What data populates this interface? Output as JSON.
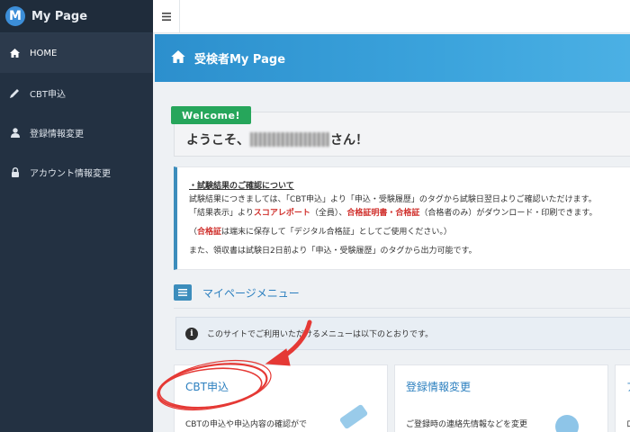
{
  "brand": {
    "logo_letter": "M",
    "title": "My Page"
  },
  "sidebar": {
    "items": [
      {
        "label": "HOME",
        "icon": "home-icon",
        "active": true
      },
      {
        "label": "CBT申込",
        "icon": "pencil-icon",
        "active": false
      },
      {
        "label": "登録情報変更",
        "icon": "user-icon",
        "active": false
      },
      {
        "label": "アカウント情報変更",
        "icon": "lock-icon",
        "active": false
      }
    ]
  },
  "topbar": {
    "menu_icon": "hamburger-icon"
  },
  "header": {
    "title": "受検者My Page",
    "icon": "home-icon"
  },
  "welcome": {
    "badge": "Welcome!",
    "greeting_prefix": "ようこそ、",
    "greeting_suffix": "さん！"
  },
  "notice": {
    "title": "・試験結果のご確認について",
    "line1": "試験結果につきましては、「CBT申込」より「申込・受験履歴」のタグから試験日翌日よりご確認いただけます。",
    "line2_a": "「結果表示」より",
    "line2_b": "スコアレポート",
    "line2_c": "（全員）、",
    "line2_d": "合格証明書・合格証",
    "line2_e": "（合格者のみ）がダウンロード・印刷できます。",
    "line3_a": "（",
    "line3_b": "合格証",
    "line3_c": "は端末に保存して「デジタル合格証」としてご使用ください。）",
    "line4": "また、領収書は試験日2日前より「申込・受験履歴」のタグから出力可能です。"
  },
  "menu_section": {
    "title": "マイページメニュー",
    "icon": "list-icon"
  },
  "info_banner": {
    "text": "このサイトでご利用いただけるメニューは以下のとおりです。",
    "icon": "info-icon"
  },
  "cards": [
    {
      "title": "CBT申込",
      "desc": "CBTの申込や申込内容の確認がで"
    },
    {
      "title": "登録情報変更",
      "desc": "ご登録時の連絡先情報などを変更"
    },
    {
      "title": "ア",
      "desc": "ロ"
    }
  ],
  "colors": {
    "sidebar_bg": "#233142",
    "header_blue": "#2c8fcd",
    "welcome_green": "#26a65b",
    "notice_red": "#d0312d",
    "link_blue": "#2b7fbf",
    "annotation_red": "#e53935"
  }
}
